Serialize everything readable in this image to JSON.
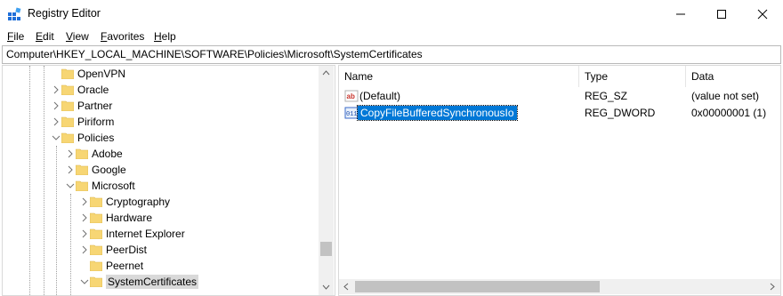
{
  "window": {
    "title": "Registry Editor",
    "minimize_icon": "minimize-icon",
    "maximize_icon": "maximize-icon",
    "close_icon": "close-icon"
  },
  "menu": {
    "file": "File",
    "edit": "Edit",
    "view": "View",
    "favorites": "Favorites",
    "help": "Help"
  },
  "address": {
    "path": "Computer\\HKEY_LOCAL_MACHINE\\SOFTWARE\\Policies\\Microsoft\\SystemCertificates"
  },
  "tree": {
    "items": [
      {
        "label": "OpenVPN"
      },
      {
        "label": "Oracle"
      },
      {
        "label": "Partner"
      },
      {
        "label": "Piriform"
      },
      {
        "label": "Policies"
      },
      {
        "label": "Adobe"
      },
      {
        "label": "Google"
      },
      {
        "label": "Microsoft"
      },
      {
        "label": "Cryptography"
      },
      {
        "label": "Hardware"
      },
      {
        "label": "Internet Explorer"
      },
      {
        "label": "PeerDist"
      },
      {
        "label": "Peernet"
      },
      {
        "label": "SystemCertificates"
      }
    ]
  },
  "values": {
    "columns": {
      "name": "Name",
      "type": "Type",
      "data": "Data"
    },
    "rows": [
      {
        "name": "(Default)",
        "type": "REG_SZ",
        "data": "(value not set)",
        "icon": "string-value-icon"
      },
      {
        "name": "CopyFileBufferedSynchronousIo",
        "type": "REG_DWORD",
        "data": "0x00000001 (1)",
        "icon": "dword-value-icon"
      }
    ]
  },
  "colors": {
    "folder": "#f7d674",
    "selection": "#0078d7",
    "tree_selection": "#d9d9d9"
  }
}
